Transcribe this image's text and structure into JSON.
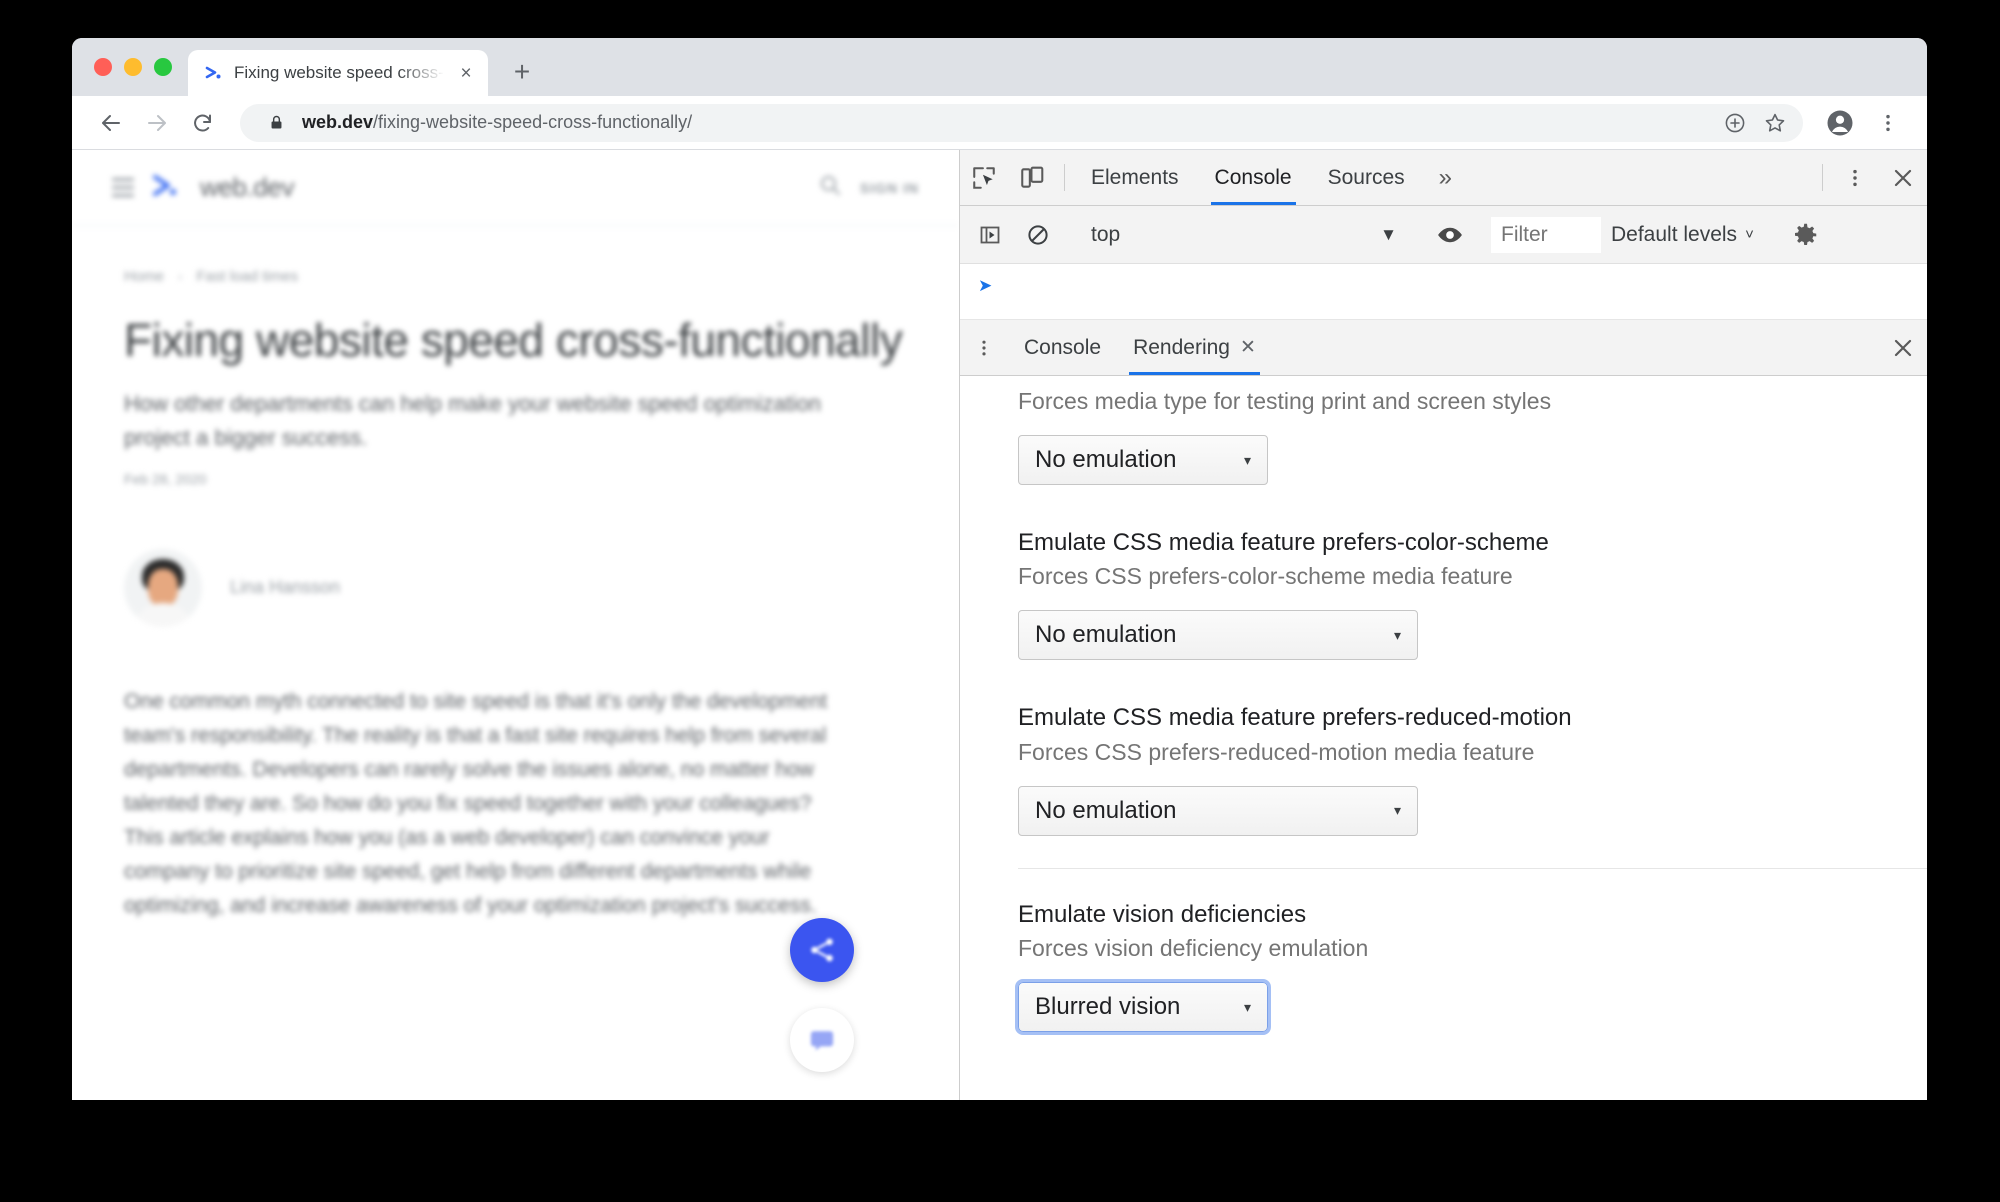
{
  "browser": {
    "tab": {
      "title": "Fixing website speed cross-fun",
      "favicon": "webdev-logo-icon",
      "close_label": "×"
    },
    "new_tab_label": "+",
    "nav": {
      "back": "←",
      "forward": "→",
      "reload": "↻"
    },
    "omnibox": {
      "lock_icon": "lock-icon",
      "url_domain": "web.dev",
      "url_path": "/fixing-website-speed-cross-functionally/",
      "install_icon": "install-app-icon",
      "bookmark_icon": "star-icon"
    },
    "profile_icon": "profile-avatar-icon",
    "menu_icon": "kebab-menu-icon"
  },
  "webpage": {
    "header": {
      "menu_icon": "hamburger-menu-icon",
      "logo_text": "web.dev",
      "search_icon": "search-icon",
      "signin_label": "SIGN IN"
    },
    "breadcrumb": {
      "home": "Home",
      "separator": "›",
      "current": "Fast load times"
    },
    "title": "Fixing website speed cross-functionally",
    "subtitle": "How other departments can help make your website speed optimization project a bigger success.",
    "date": "Feb 28, 2020",
    "author": {
      "name": "Lina Hansson",
      "avatar": "author-photo"
    },
    "body": "One common myth connected to site speed is that it's only the development team's responsibility. The reality is that a fast site requires help from several departments. Developers can rarely solve the issues alone, no matter how talented they are. So how do you fix speed together with your colleagues? This article explains how you (as a web developer) can convince your company to prioritize site speed, get help from different departments while optimizing, and increase awareness of your optimization project's success.",
    "fab_share_icon": "share-icon",
    "fab_feedback_icon": "feedback-icon"
  },
  "devtools": {
    "inspect_icon": "inspect-element-icon",
    "device_icon": "device-toolbar-icon",
    "tabs": [
      {
        "label": "Elements",
        "active": false
      },
      {
        "label": "Console",
        "active": true
      },
      {
        "label": "Sources",
        "active": false
      }
    ],
    "overflow_label": "»",
    "settings_icon": "kebab-menu-icon",
    "close_icon": "close-icon",
    "console_toolbar": {
      "sidebar_icon": "console-sidebar-icon",
      "clear_icon": "clear-console-icon",
      "context": "top",
      "context_arrow": "▼",
      "eye_icon": "live-expression-eye-icon",
      "filter_placeholder": "Filter",
      "filter_value": "",
      "levels_label": "Default levels",
      "levels_arrow": "˅",
      "gear_icon": "settings-gear-icon"
    },
    "drawer": {
      "menu_icon": "kebab-menu-icon",
      "tabs": [
        {
          "label": "Console",
          "active": false,
          "closable": false
        },
        {
          "label": "Rendering",
          "active": true,
          "closable": true,
          "close": "✕"
        }
      ],
      "close_icon": "✕"
    },
    "rendering": {
      "sections": [
        {
          "title": "",
          "desc": "Forces media type for testing print and screen styles",
          "value": "No emulation",
          "arrow": "▾",
          "focused": false,
          "divided": false,
          "wide": false
        },
        {
          "title": "Emulate CSS media feature prefers-color-scheme",
          "desc": "Forces CSS prefers-color-scheme media feature",
          "value": "No emulation",
          "arrow": "▾",
          "focused": false,
          "divided": false,
          "wide": true
        },
        {
          "title": "Emulate CSS media feature prefers-reduced-motion",
          "desc": "Forces CSS prefers-reduced-motion media feature",
          "value": "No emulation",
          "arrow": "▾",
          "focused": false,
          "divided": false,
          "wide": true
        },
        {
          "title": "Emulate vision deficiencies",
          "desc": "Forces vision deficiency emulation",
          "value": "Blurred vision",
          "arrow": "▾",
          "focused": true,
          "divided": true,
          "wide": false
        }
      ]
    }
  },
  "colors": {
    "accent_blue": "#1a73e8",
    "fab_blue": "#3b55f0",
    "chrome_tabstrip": "#dee1e6",
    "devtools_bg": "#f3f3f3",
    "focus_ring": "#a5c0f5"
  }
}
